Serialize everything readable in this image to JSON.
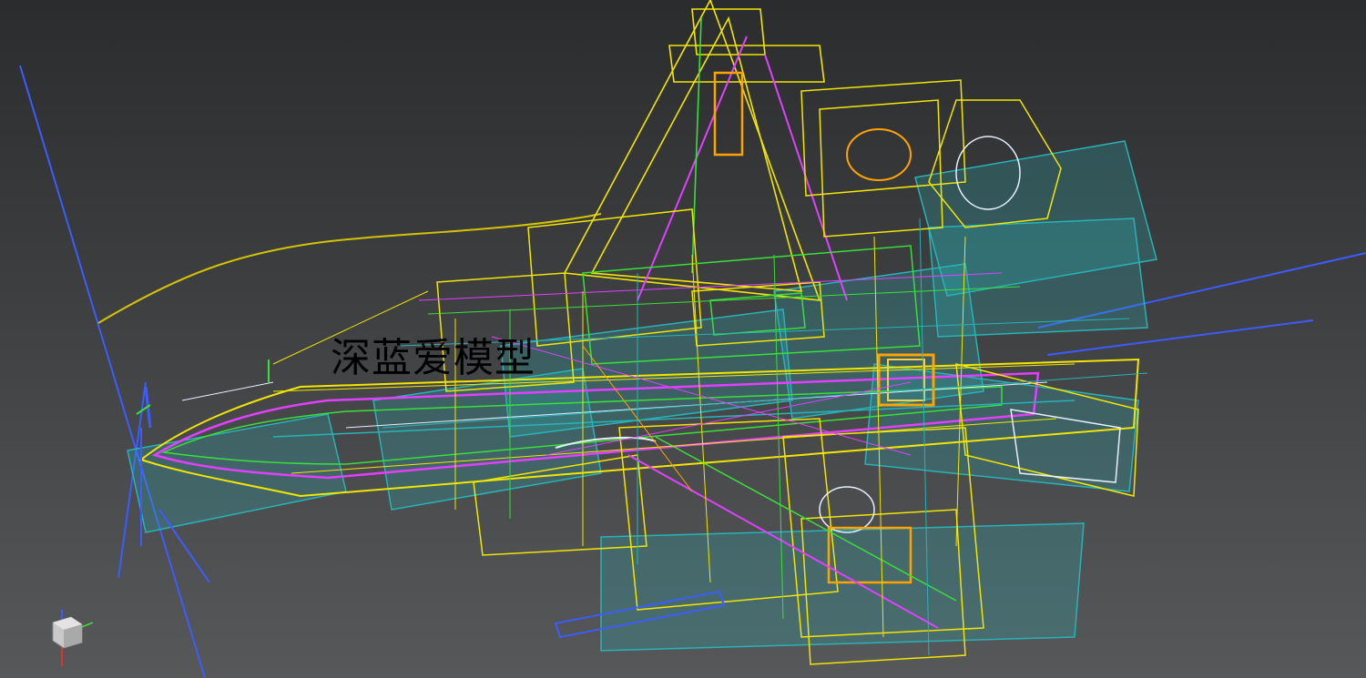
{
  "viewport": {
    "label": "perspective-viewport",
    "background_top": "#2b2c2e",
    "background_bottom": "#575859"
  },
  "watermark": {
    "text": "深蓝爱模型"
  },
  "wire_colors": {
    "yellow": "#f2e600",
    "magenta": "#e040ff",
    "cyan": "#27b3b8",
    "green": "#39e039",
    "blue": "#3c5cff",
    "orange": "#ffa300",
    "white": "#e6f0ff"
  },
  "gizmo": {
    "axes": [
      "x",
      "y",
      "z"
    ],
    "icon": "view-cube-icon"
  }
}
